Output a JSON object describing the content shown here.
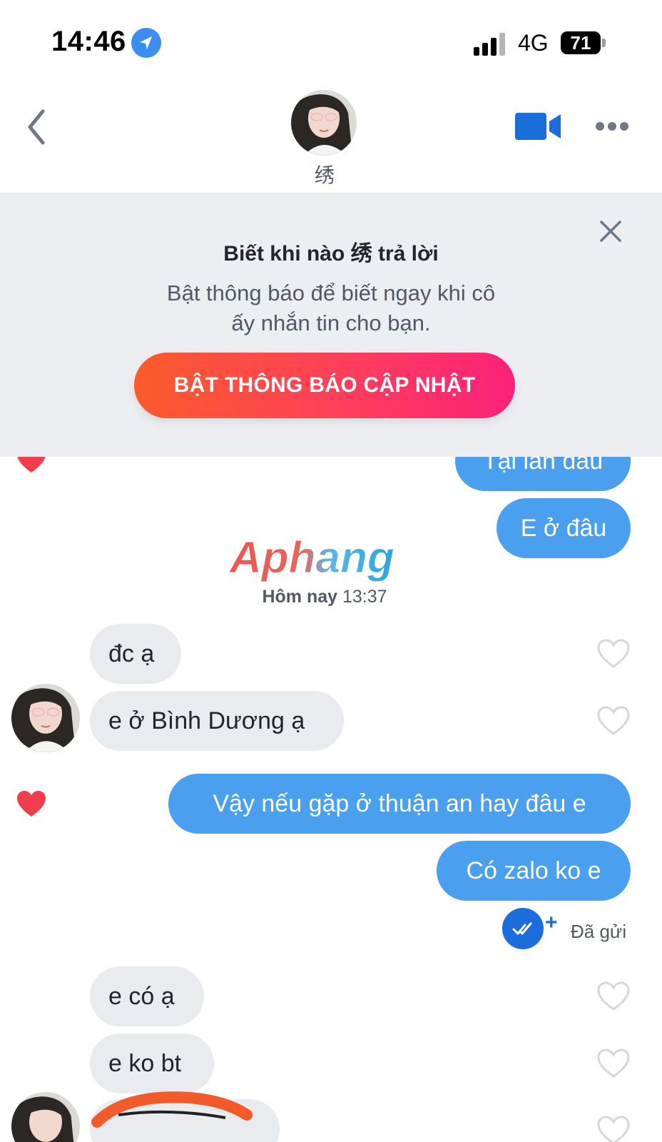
{
  "status_bar": {
    "time": "14:46",
    "network": "4G",
    "battery": "71"
  },
  "header": {
    "contact_name": "绣"
  },
  "banner": {
    "title": "Biết khi nào 绣 trả lời",
    "description_line1": "Bật thông báo để biết ngay khi cô",
    "description_line2": "ấy nhắn tin cho bạn.",
    "button_label": "BẬT THÔNG BÁO CẬP NHẬT"
  },
  "watermark": {
    "text": "Aphang"
  },
  "messages": {
    "partial_out": "Tại lần đầu",
    "out_1": "E ở đâu",
    "date_day": "Hôm nay",
    "date_time": "13:37",
    "in_1": "đc ạ",
    "in_2": "e ở Bình Dương ạ",
    "out_2": "Vậy nếu gặp ở thuận an hay đâu e",
    "out_3": "Có zalo ko e",
    "status_sent": "Đã gửi",
    "status_plus": "+",
    "in_3": "e có ạ",
    "in_4": "e ko bt"
  },
  "colors": {
    "outgoing_bubble": "#4aa0ef",
    "incoming_bubble": "#e9ebee",
    "accent_gradient_start": "#fd5a2c",
    "accent_gradient_end": "#fd2179",
    "like_red": "#f23e4c"
  },
  "icons": [
    "location-arrow-icon",
    "signal-icon",
    "battery-icon",
    "back-chevron-icon",
    "video-call-icon",
    "more-options-icon",
    "close-icon",
    "heart-icon",
    "read-receipt-icon"
  ]
}
